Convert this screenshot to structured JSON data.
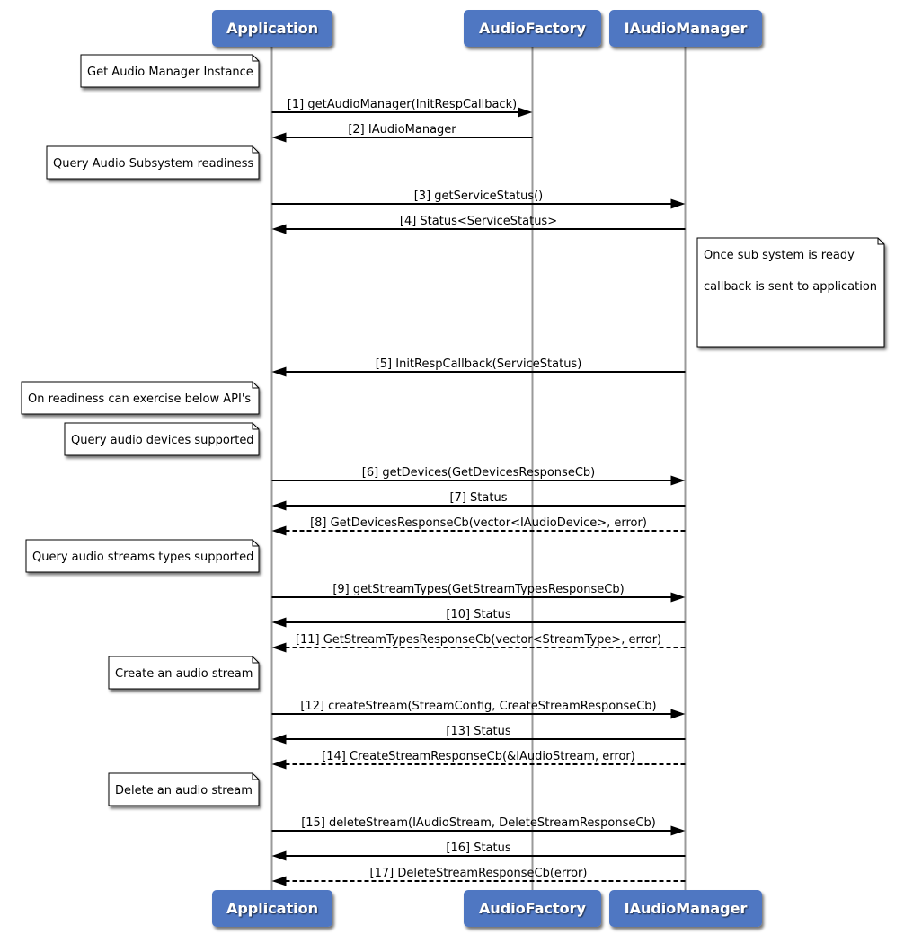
{
  "colors": {
    "participant_fill": "#4f77c2",
    "participant_text": "#ffffff",
    "lifeline": "#9a9a9a",
    "arrow": "#000000",
    "note_fill": "#ffffff",
    "note_border": "#000000"
  },
  "participants": [
    {
      "id": "app",
      "label": "Application"
    },
    {
      "id": "factory",
      "label": "AudioFactory"
    },
    {
      "id": "manager",
      "label": "IAudioManager"
    }
  ],
  "events": [
    {
      "kind": "note",
      "side": "left-of",
      "participant": "app",
      "lines": [
        "Get Audio Manager Instance"
      ]
    },
    {
      "kind": "message",
      "from": "app",
      "to": "factory",
      "style": "solid",
      "label": "[1] getAudioManager(InitRespCallback)"
    },
    {
      "kind": "message",
      "from": "factory",
      "to": "app",
      "style": "solid",
      "label": "[2] IAudioManager"
    },
    {
      "kind": "note",
      "side": "left-of",
      "participant": "app",
      "lines": [
        "Query Audio Subsystem readiness"
      ]
    },
    {
      "kind": "message",
      "from": "app",
      "to": "manager",
      "style": "solid",
      "label": "[3] getServiceStatus()"
    },
    {
      "kind": "message",
      "from": "manager",
      "to": "app",
      "style": "solid",
      "label": "[4] Status<ServiceStatus>"
    },
    {
      "kind": "note",
      "side": "right-of",
      "participant": "manager",
      "lines": [
        "Once sub system is ready",
        "callback is sent to application"
      ]
    },
    {
      "kind": "message",
      "from": "manager",
      "to": "app",
      "style": "solid",
      "label": "[5] InitRespCallback(ServiceStatus)"
    },
    {
      "kind": "note",
      "side": "left-of",
      "participant": "app",
      "lines": [
        "On readiness can exercise below API's"
      ]
    },
    {
      "kind": "note",
      "side": "left-of",
      "participant": "app",
      "lines": [
        "Query audio devices supported"
      ]
    },
    {
      "kind": "message",
      "from": "app",
      "to": "manager",
      "style": "solid",
      "label": "[6] getDevices(GetDevicesResponseCb)"
    },
    {
      "kind": "message",
      "from": "manager",
      "to": "app",
      "style": "solid",
      "label": "[7] Status"
    },
    {
      "kind": "message",
      "from": "manager",
      "to": "app",
      "style": "dashed",
      "label": "[8] GetDevicesResponseCb(vector<IAudioDevice>, error)"
    },
    {
      "kind": "note",
      "side": "left-of",
      "participant": "app",
      "lines": [
        "Query audio streams types supported"
      ]
    },
    {
      "kind": "message",
      "from": "app",
      "to": "manager",
      "style": "solid",
      "label": "[9] getStreamTypes(GetStreamTypesResponseCb)"
    },
    {
      "kind": "message",
      "from": "manager",
      "to": "app",
      "style": "solid",
      "label": "[10] Status"
    },
    {
      "kind": "message",
      "from": "manager",
      "to": "app",
      "style": "dashed",
      "label": "[11] GetStreamTypesResponseCb(vector<StreamType>, error)"
    },
    {
      "kind": "note",
      "side": "left-of",
      "participant": "app",
      "lines": [
        "Create an audio stream"
      ]
    },
    {
      "kind": "message",
      "from": "app",
      "to": "manager",
      "style": "solid",
      "label": "[12] createStream(StreamConfig, CreateStreamResponseCb)"
    },
    {
      "kind": "message",
      "from": "manager",
      "to": "app",
      "style": "solid",
      "label": "[13] Status"
    },
    {
      "kind": "message",
      "from": "manager",
      "to": "app",
      "style": "dashed",
      "label": "[14] CreateStreamResponseCb(&IAudioStream, error)"
    },
    {
      "kind": "note",
      "side": "left-of",
      "participant": "app",
      "lines": [
        "Delete an audio stream"
      ]
    },
    {
      "kind": "message",
      "from": "app",
      "to": "manager",
      "style": "solid",
      "label": "[15] deleteStream(IAudioStream, DeleteStreamResponseCb)"
    },
    {
      "kind": "message",
      "from": "manager",
      "to": "app",
      "style": "solid",
      "label": "[16] Status"
    },
    {
      "kind": "message",
      "from": "manager",
      "to": "app",
      "style": "dashed",
      "label": "[17] DeleteStreamResponseCb(error)"
    }
  ]
}
